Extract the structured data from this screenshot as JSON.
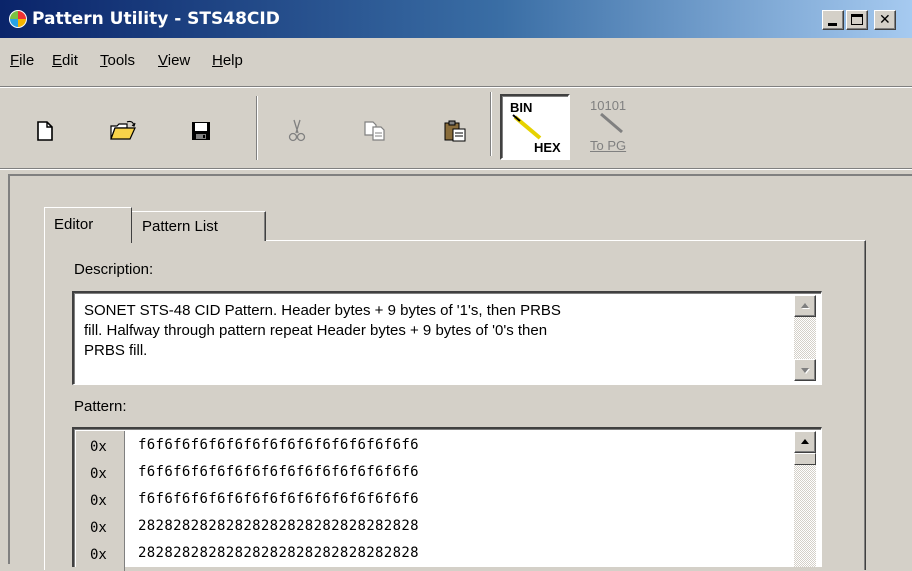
{
  "window": {
    "title": "Pattern Utility - STS48CID"
  },
  "menu": [
    {
      "label": "File",
      "accel": "F",
      "rest": "ile"
    },
    {
      "label": "Edit",
      "accel": "E",
      "rest": "dit"
    },
    {
      "label": "Tools",
      "accel": "T",
      "rest": "ools"
    },
    {
      "label": "View",
      "accel": "V",
      "rest": "iew"
    },
    {
      "label": "Help",
      "accel": "H",
      "rest": "elp"
    }
  ],
  "toolbar": {
    "buttons": [
      "new-document-icon",
      "open-folder-icon",
      "save-disk-icon",
      "cut-scissors-icon",
      "copy-icon",
      "paste-clipboard-icon"
    ],
    "bin_hex": {
      "top": "BIN",
      "bottom": "HEX"
    },
    "to_pg": {
      "top": "10101",
      "bottom": "To PG"
    }
  },
  "tabs": {
    "editor": "Editor",
    "pattern_list": "Pattern List"
  },
  "editor": {
    "description_label": "Description:",
    "description_lines": [
      "SONET STS-48 CID Pattern. Header bytes + 9 bytes of '1's, then PRBS",
      "fill. Halfway through pattern repeat Header bytes + 9 bytes of '0's then",
      "PRBS fill."
    ],
    "pattern_label": "Pattern:",
    "pattern_rows": [
      {
        "prefix": "0x",
        "hex": "f6f6f6f6f6f6f6f6f6f6f6f6f6f6f6f6"
      },
      {
        "prefix": "0x",
        "hex": "f6f6f6f6f6f6f6f6f6f6f6f6f6f6f6f6"
      },
      {
        "prefix": "0x",
        "hex": "f6f6f6f6f6f6f6f6f6f6f6f6f6f6f6f6"
      },
      {
        "prefix": "0x",
        "hex": "28282828282828282828282828282828"
      },
      {
        "prefix": "0x",
        "hex": "28282828282828282828282828282828"
      }
    ]
  },
  "colors": {
    "title_start": "#0a246a",
    "title_end": "#a6caf0",
    "face": "#d4d0c8"
  }
}
